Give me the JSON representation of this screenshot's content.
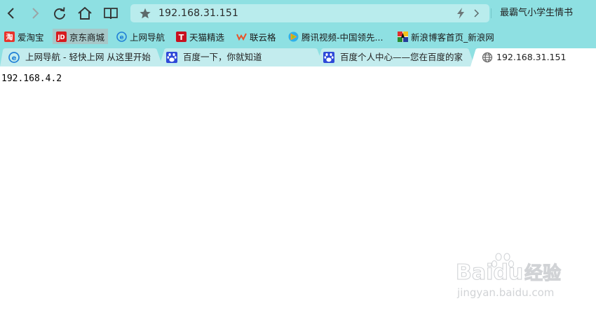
{
  "toolbar": {
    "url": "192.168.31.151",
    "search_suggestion": "最霸气小学生情书"
  },
  "bookmarks": [
    {
      "label": "爱淘宝",
      "icon": "taobao-icon"
    },
    {
      "label": "京东商城",
      "icon": "jd-icon"
    },
    {
      "label": "上网导航",
      "icon": "ie-navigation-icon"
    },
    {
      "label": "天猫精选",
      "icon": "tmall-icon"
    },
    {
      "label": "联云格",
      "icon": "lianyun-icon"
    },
    {
      "label": "腾讯视频-中国领先...",
      "icon": "tencent-video-icon"
    },
    {
      "label": "新浪博客首页_新浪网",
      "icon": "sina-blog-icon"
    }
  ],
  "tabs": [
    {
      "title": "上网导航 - 轻快上网 从这里开始",
      "icon": "ie-navigation-icon"
    },
    {
      "title": "百度一下，你就知道",
      "icon": "baidu-paw-icon"
    },
    {
      "title": "百度个人中心——您在百度的家",
      "icon": "baidu-paw-icon"
    },
    {
      "title": "192.168.31.151",
      "icon": "globe-icon"
    }
  ],
  "content": {
    "text": "192.168.4.2"
  },
  "watermark": {
    "brand": "Baidu",
    "name": "经验",
    "domain": "jingyan.baidu.com"
  },
  "colors": {
    "chrome_bg": "#8ee0e2",
    "address_bg": "#b9eced",
    "active_tab_bg": "#ffffff",
    "inactive_tab_bg": "#c3ecee",
    "active_bookmark_bg": "#a7c7c8"
  }
}
